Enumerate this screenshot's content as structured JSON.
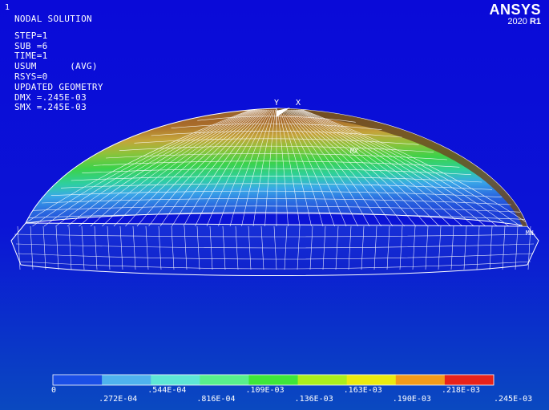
{
  "window": {
    "number": "1"
  },
  "brand": {
    "name": "ANSYS",
    "version_year": "2020",
    "version_rel": "R1"
  },
  "info": {
    "title": "NODAL SOLUTION",
    "step": "STEP=1",
    "sub": "SUB =6",
    "time": "TIME=1",
    "usum": "USUM      (AVG)",
    "rsys": "RSYS=0",
    "geometry": "UPDATED GEOMETRY",
    "dmx": "DMX =.245E-03",
    "smx": "SMX =.245E-03"
  },
  "markers": {
    "max": "MX",
    "min": "MN"
  },
  "triad": {
    "y": "Y",
    "x": "X"
  },
  "contour": {
    "colors": [
      "#1a4ee6",
      "#4fb2ee",
      "#5ee6d6",
      "#58f08c",
      "#3ee63a",
      "#aaee1c",
      "#eaea10",
      "#f29a1a",
      "#e8221a"
    ],
    "labels_bottom": [
      "0",
      ".544E-04",
      ".109E-03",
      ".163E-03",
      ".218E-03"
    ],
    "labels_top": [
      ".272E-04",
      ".816E-04",
      ".136E-03",
      ".190E-03",
      ".245E-03"
    ]
  }
}
